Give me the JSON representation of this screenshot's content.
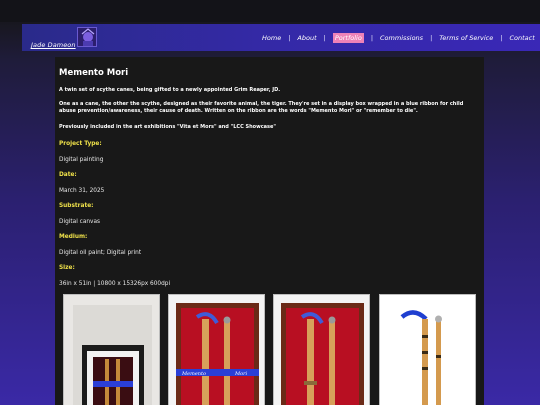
{
  "header": {
    "brand": "Jade Dameon",
    "nav": [
      {
        "label": "Home",
        "active": false
      },
      {
        "label": "About",
        "active": false
      },
      {
        "label": "Portfolio",
        "active": true
      },
      {
        "label": "Commissions",
        "active": false
      },
      {
        "label": "Terms of Service",
        "active": false
      },
      {
        "label": "Contact",
        "active": false
      }
    ],
    "separator": "|"
  },
  "artwork": {
    "title": "Memento Mori",
    "desc1": "A twin set of scythe canes, being gifted to a newly appointed Grim Reaper, JD.",
    "desc2": "One as a cane, the other the scythe, designed as their favorite animal, the tiger. They're set in a display box wrapped in a blue ribbon for child abuse prevention/awareness, their cause of death. Written on the ribbon are the words \"Memento Mori\" or \"remember to die\".",
    "desc3": "Previously included in the art exhibitions \"Vita et Mors\" and \"LCC Showcase\"",
    "details": [
      {
        "label": "Project Type:",
        "value": "Digital painting"
      },
      {
        "label": "Date:",
        "value": "March 31, 2025"
      },
      {
        "label": "Substrate:",
        "value": "Digital canvas"
      },
      {
        "label": "Medium:",
        "value": "Digital oil paint; Digital print"
      },
      {
        "label": "Size:",
        "value": "36in x 51in | 10800 x 15326px 600dpi"
      }
    ],
    "ribbon_text": "Memento Mori"
  },
  "colors": {
    "accent_yellow": "#f0e24a",
    "nav_active": "#ee82b8",
    "ribbon_blue": "#2a3fd6",
    "frame_red": "#c8102e"
  }
}
